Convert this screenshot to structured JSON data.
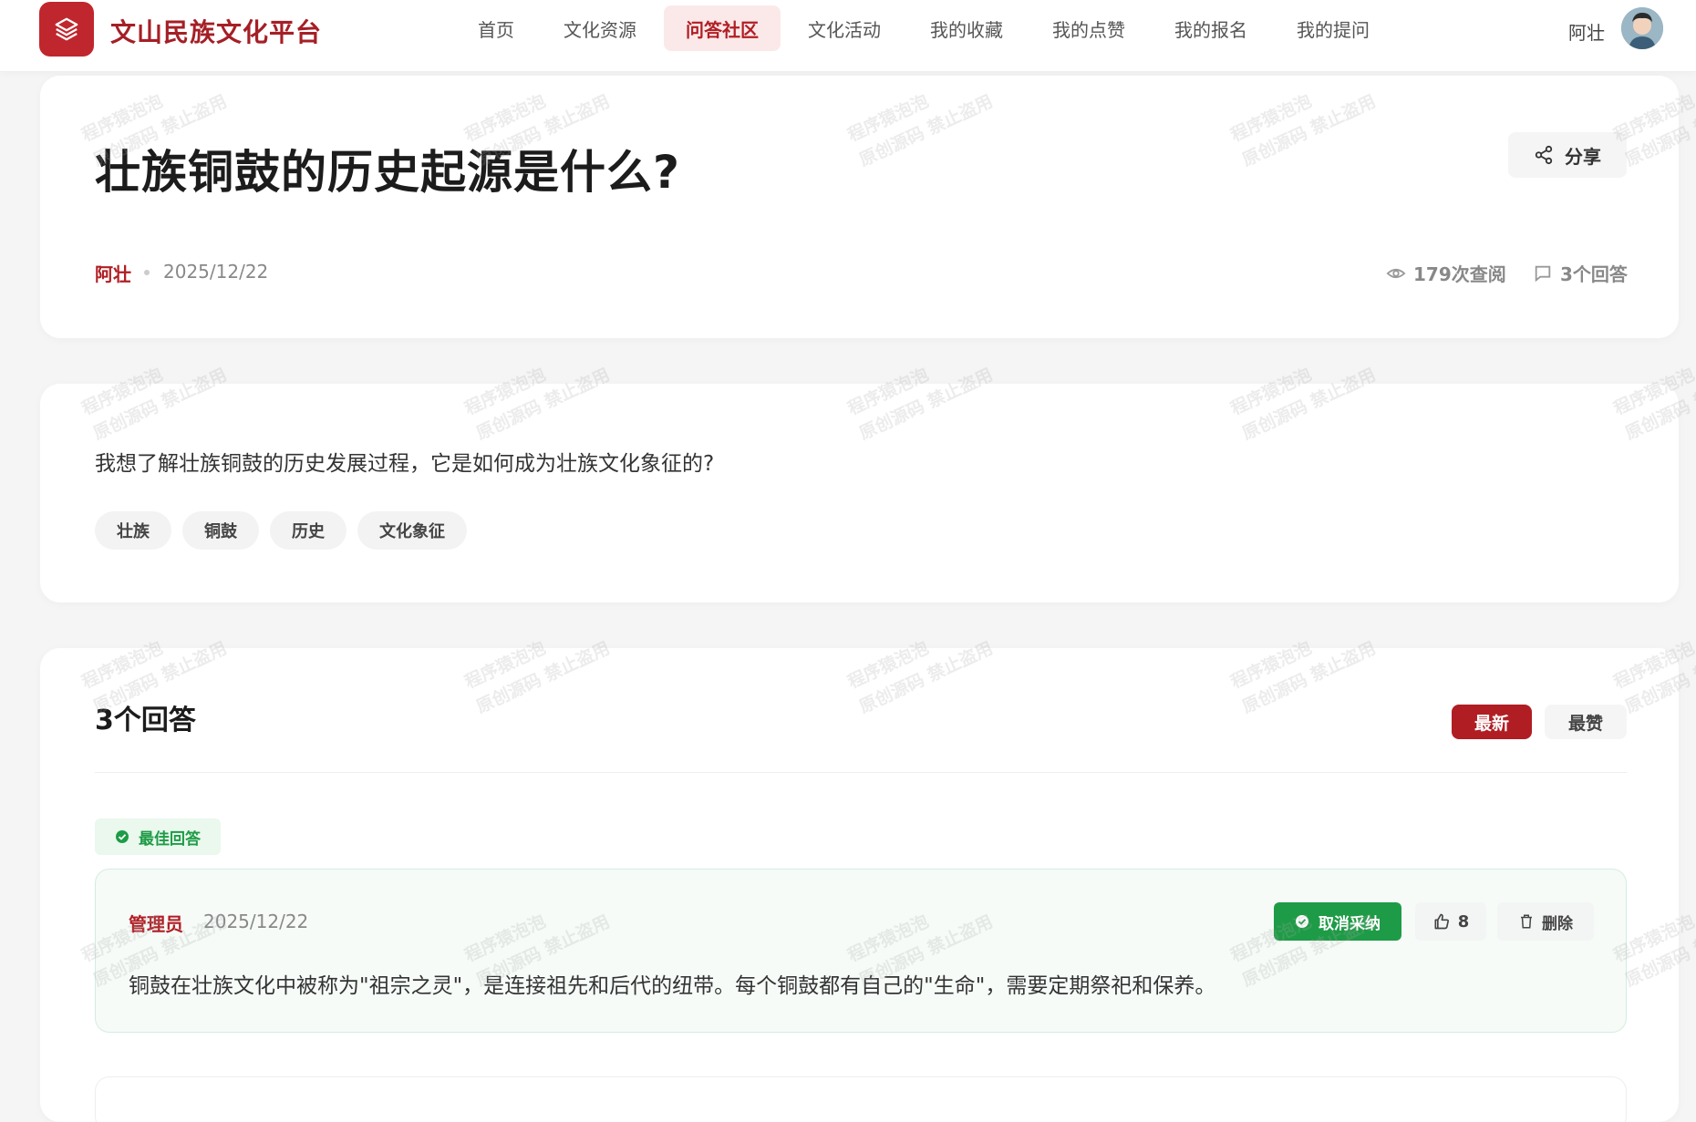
{
  "header": {
    "brand": "文山民族文化平台",
    "nav": [
      {
        "label": "首页",
        "active": false
      },
      {
        "label": "文化资源",
        "active": false
      },
      {
        "label": "问答社区",
        "active": true
      },
      {
        "label": "文化活动",
        "active": false
      },
      {
        "label": "我的收藏",
        "active": false
      },
      {
        "label": "我的点赞",
        "active": false
      },
      {
        "label": "我的报名",
        "active": false
      },
      {
        "label": "我的提问",
        "active": false
      }
    ],
    "user_name": "阿壮"
  },
  "question": {
    "title": "壮族铜鼓的历史起源是什么?",
    "share_label": "分享",
    "author": "阿壮",
    "date": "2025/12/22",
    "views": "179次查阅",
    "answer_count": "3个回答",
    "body": "我想了解壮族铜鼓的历史发展过程，它是如何成为壮族文化象征的?",
    "tags": [
      "壮族",
      "铜鼓",
      "历史",
      "文化象征"
    ]
  },
  "answers": {
    "heading": "3个回答",
    "sort_new": "最新",
    "sort_hot": "最赞",
    "best_badge": "最佳回答",
    "items": [
      {
        "author": "管理员",
        "date": "2025/12/22",
        "text": "铜鼓在壮族文化中被称为\"祖宗之灵\"，是连接祖先和后代的纽带。每个铜鼓都有自己的\"生命\"，需要定期祭祀和保养。",
        "unaccept_label": "取消采纳",
        "likes": "8",
        "delete_label": "删除"
      }
    ]
  },
  "watermark": {
    "line1": "程序猿泡泡",
    "line2": "原创源码 禁止盗用"
  },
  "colors": {
    "brand_red": "#b01e24",
    "accent_green": "#1e9b46",
    "page_bg": "#f5f5f5"
  }
}
